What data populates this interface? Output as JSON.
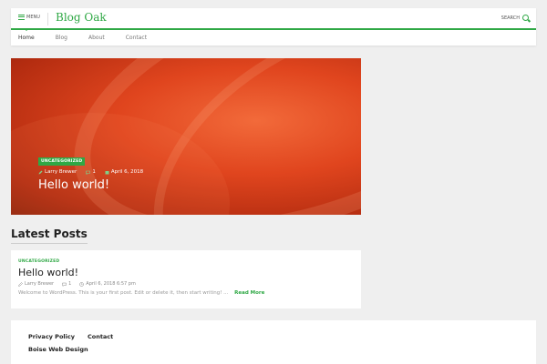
{
  "header": {
    "menu_label": "MENU",
    "brand": "Blog Oak",
    "search_label": "SEARCH",
    "nav": [
      "Home",
      "Blog",
      "About",
      "Contact"
    ]
  },
  "hero": {
    "category": "UNCATEGORIZED",
    "author": "Larry Brewer",
    "comments": "1",
    "date": "April 6, 2018",
    "title": "Hello world!"
  },
  "latest": {
    "heading": "Latest Posts",
    "post": {
      "category": "UNCATEGORIZED",
      "title": "Hello world!",
      "author": "Larry Brewer",
      "comments": "1",
      "date": "April 6, 2018 6:57 pm",
      "excerpt": "Welcome to WordPress. This is your first post. Edit or delete it, then start writing! ...",
      "read_more": "Read More"
    }
  },
  "footer": {
    "links": [
      "Privacy Policy",
      "Contact"
    ],
    "site": "Boise Web Design"
  },
  "colors": {
    "accent": "#2fa845"
  }
}
